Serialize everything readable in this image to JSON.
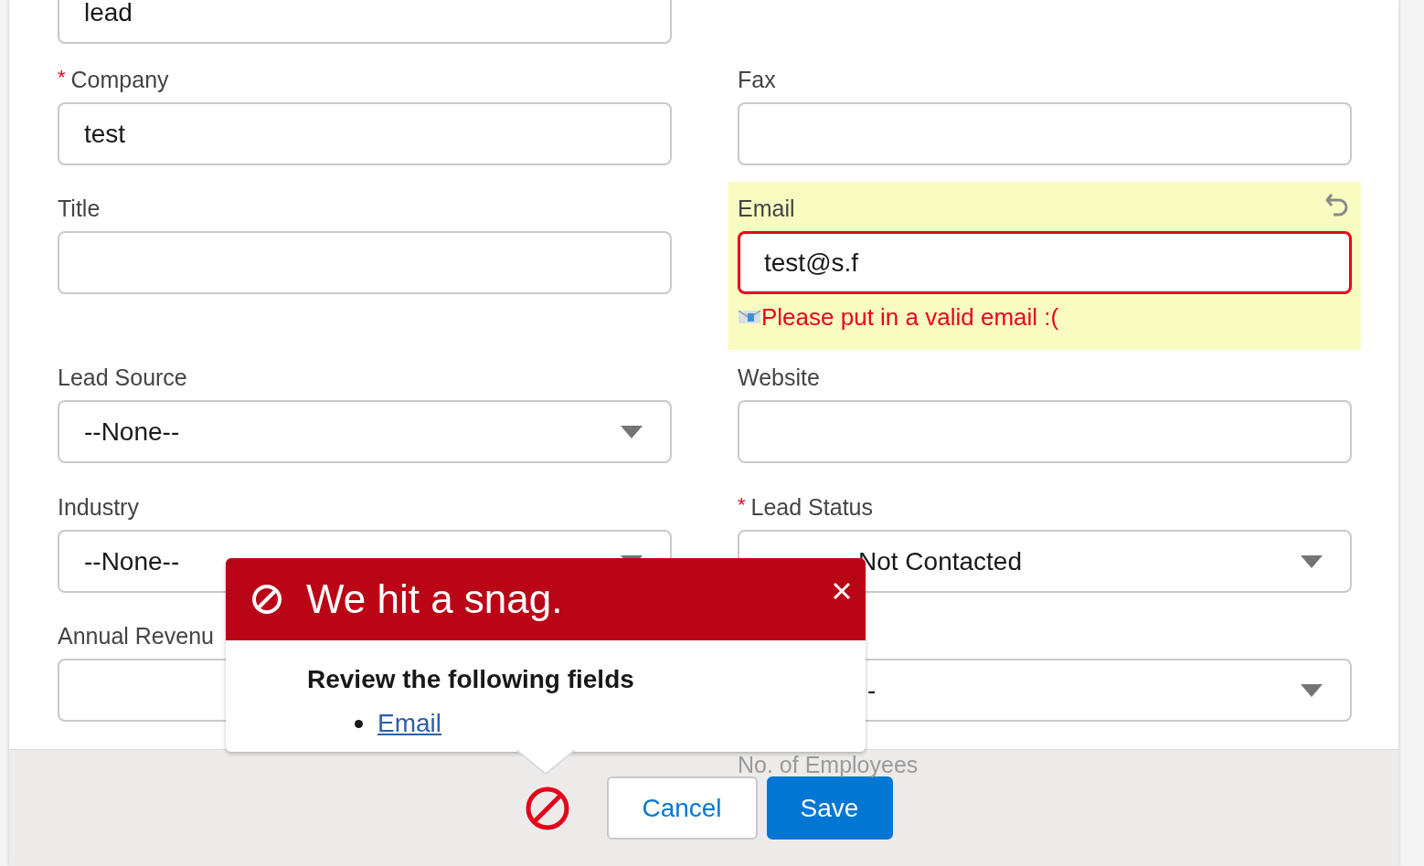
{
  "left_fields": [
    {
      "kind": "text",
      "value": "lead",
      "invalid": false
    },
    {
      "kind": "text",
      "label": "Company",
      "value": "test",
      "required_mark": "*",
      "invalid": false
    },
    {
      "kind": "text",
      "label": "Title",
      "invalid": false
    },
    {
      "kind": "select",
      "label": "Lead Source",
      "value": "--None--",
      "invalid": false
    },
    {
      "kind": "select",
      "label": "Industry",
      "value": "--None--",
      "invalid": false
    },
    {
      "kind": "text",
      "label": "Annual Revenu",
      "invalid": false
    }
  ],
  "right_fields": [
    {
      "kind": "text",
      "label": "Fax",
      "invalid": false
    },
    {
      "kind": "text",
      "label": "Email",
      "value": "test@s.f",
      "invalid": true,
      "error": "Please put in a valid email :("
    },
    {
      "kind": "text",
      "label": "Website",
      "invalid": false
    },
    {
      "kind": "select",
      "label": "Lead Status",
      "value": "Not Contacted",
      "required_mark": "*",
      "invalid": false
    },
    {
      "kind": "select",
      "value": "-",
      "invalid": false
    },
    {
      "kind": "label",
      "label": "No. of Employees"
    }
  ],
  "error_popover": {
    "title": "We hit a snag.",
    "heading": "Review the following fields",
    "links": [
      "Email"
    ]
  },
  "footer": {
    "buttons": [
      {
        "label": "Cancel",
        "kind": "neutral"
      },
      {
        "label": "Save",
        "kind": "brand"
      }
    ]
  }
}
